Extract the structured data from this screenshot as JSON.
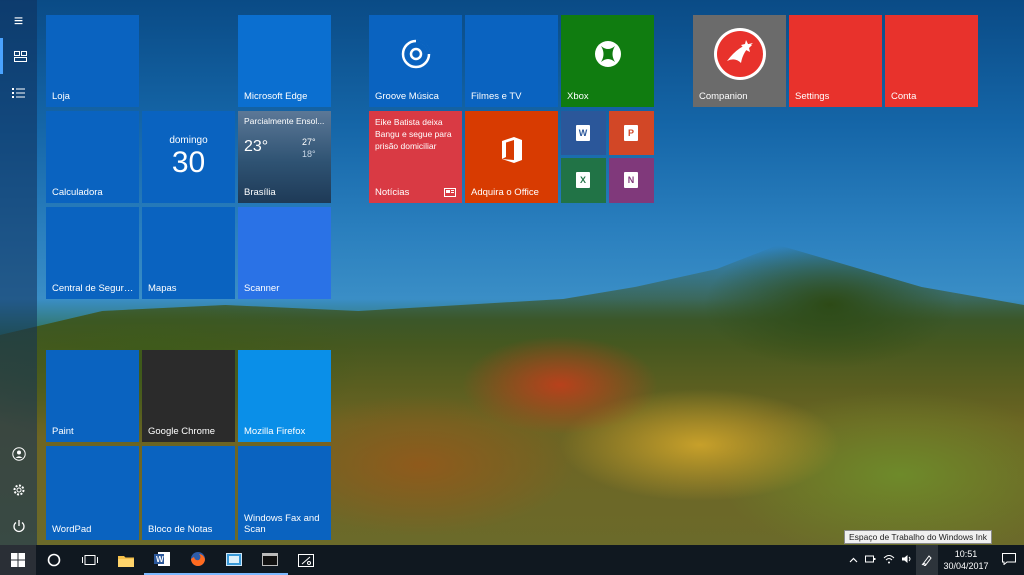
{
  "start": {
    "group1": {
      "loja": "Loja",
      "edge": "Microsoft Edge",
      "calculadora": "Calculadora",
      "calendar_day": "domingo",
      "calendar_date": "30",
      "weather_desc": "Parcialmente Ensol...",
      "weather_temp": "23°",
      "weather_high": "27°",
      "weather_low": "18°",
      "weather_city": "Brasília",
      "central": "Central de Segura...",
      "mapas": "Mapas",
      "scanner": "Scanner"
    },
    "group2": {
      "groove": "Groove Música",
      "filmes": "Filmes e TV",
      "xbox": "Xbox",
      "news_headline": "Eike Batista deixa Bangu e segue para prisão domiciliar",
      "noticias": "Notícias",
      "office": "Adquira o Office"
    },
    "group3": {
      "companion": "Companion",
      "settings": "Settings",
      "conta": "Conta"
    },
    "group4": {
      "paint": "Paint",
      "chrome": "Google Chrome",
      "firefox": "Mozilla Firefox",
      "wordpad": "WordPad",
      "notas": "Bloco de Notas",
      "fax": "Windows Fax and Scan"
    }
  },
  "taskbar": {
    "tooltip": "Espaço de Trabalho do Windows Ink",
    "time": "10:51",
    "date": "30/04/2017"
  },
  "icons": {
    "hamburger": "≡",
    "start": "⊞",
    "search": "○",
    "task_view": "▭",
    "notification": "▢"
  },
  "colors": {
    "tile_blue": "#0a63c0",
    "tile_red": "#e8322c",
    "tile_green": "#107c10",
    "office_orange": "#d83b01"
  }
}
